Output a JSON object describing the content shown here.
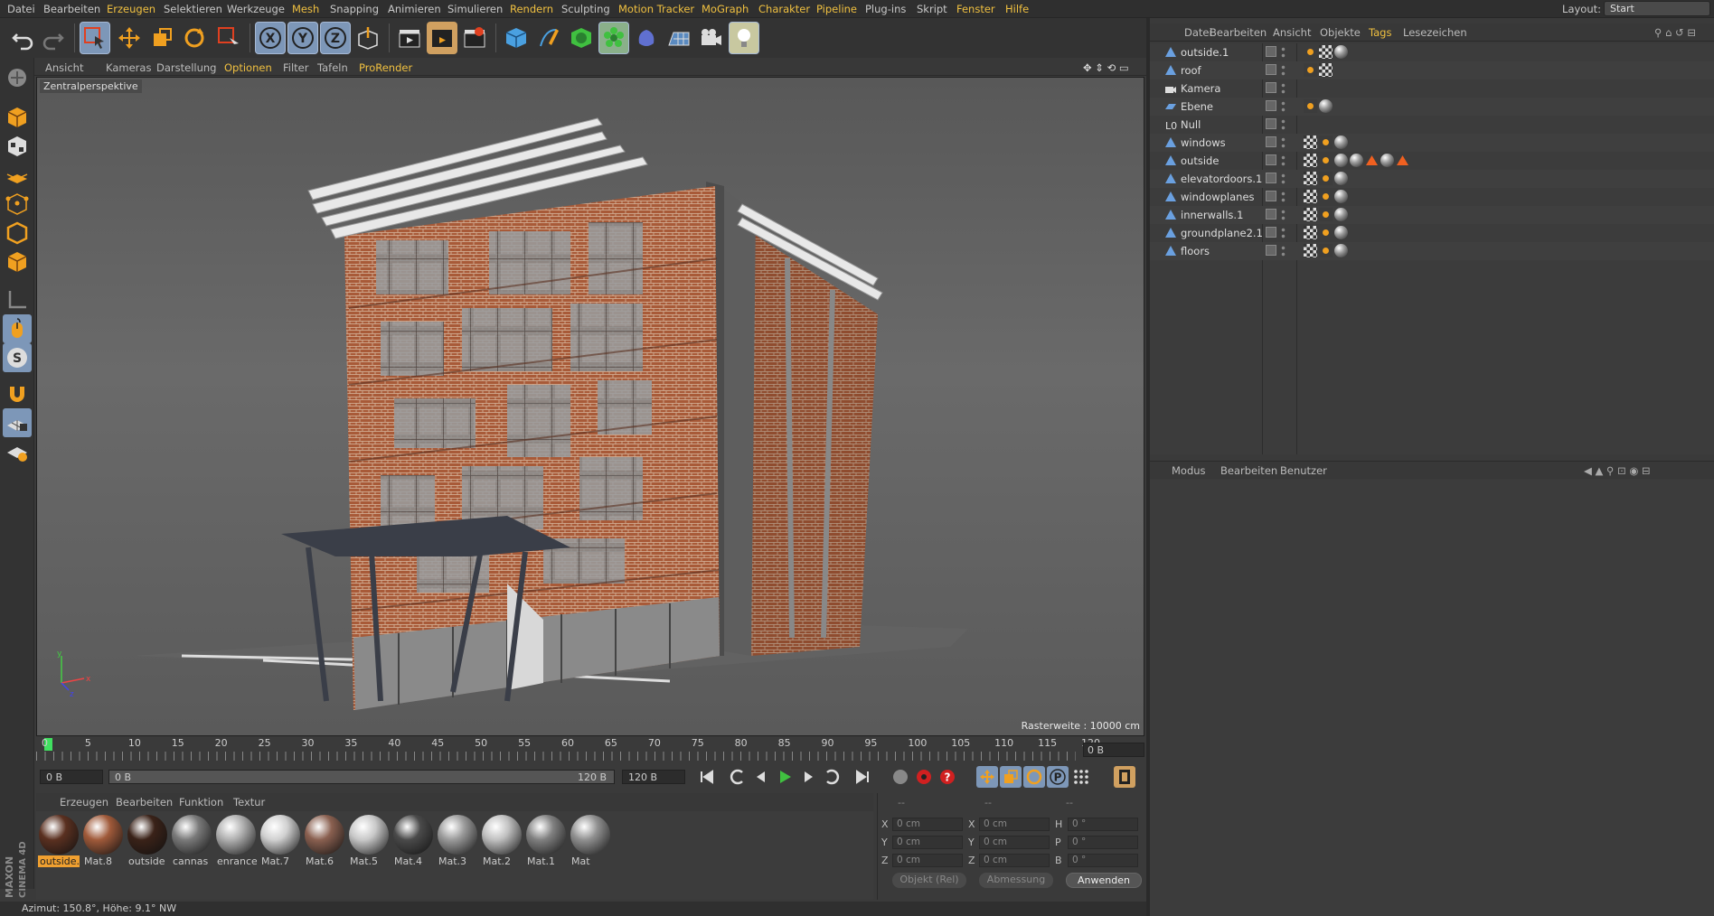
{
  "menubar": {
    "items": [
      {
        "label": "Datei",
        "hl": false
      },
      {
        "label": "Bearbeiten",
        "hl": false
      },
      {
        "label": "Erzeugen",
        "hl": true
      },
      {
        "label": "Selektieren",
        "hl": false
      },
      {
        "label": "Werkzeuge",
        "hl": false
      },
      {
        "label": "Mesh",
        "hl": true
      },
      {
        "label": "Snapping",
        "hl": false
      },
      {
        "label": "Animieren",
        "hl": false
      },
      {
        "label": "Simulieren",
        "hl": false
      },
      {
        "label": "Rendern",
        "hl": true
      },
      {
        "label": "Sculpting",
        "hl": false
      },
      {
        "label": "Motion Tracker",
        "hl": true
      },
      {
        "label": "MoGraph",
        "hl": true
      },
      {
        "label": "Charakter",
        "hl": true
      },
      {
        "label": "Pipeline",
        "hl": true
      },
      {
        "label": "Plug-ins",
        "hl": false
      },
      {
        "label": "Skript",
        "hl": false
      },
      {
        "label": "Fenster",
        "hl": true
      },
      {
        "label": "Hilfe",
        "hl": true
      }
    ],
    "layout_label": "Layout:",
    "layout_value": "Start"
  },
  "viewport": {
    "menu": [
      {
        "label": "Ansicht",
        "hl": false
      },
      {
        "label": "Kameras",
        "hl": false
      },
      {
        "label": "Darstellung",
        "hl": false
      },
      {
        "label": "Optionen",
        "hl": true
      },
      {
        "label": "Filter",
        "hl": false
      },
      {
        "label": "Tafeln",
        "hl": false
      },
      {
        "label": "ProRender",
        "hl": true
      }
    ],
    "title": "Zentralperspektive",
    "raster": "Rasterweite : 10000 cm"
  },
  "timeline": {
    "ticks": [
      "0",
      "5",
      "10",
      "15",
      "20",
      "25",
      "30",
      "35",
      "40",
      "45",
      "50",
      "55",
      "60",
      "65",
      "70",
      "75",
      "80",
      "85",
      "90",
      "95",
      "100",
      "105",
      "110",
      "115",
      "120"
    ],
    "current_frame": "0 B"
  },
  "transport": {
    "start": "0 B",
    "range_start": "0 B",
    "range_end": "120 B",
    "end": "120 B"
  },
  "materials": {
    "menu": [
      "Erzeugen",
      "Bearbeiten",
      "Funktion",
      "Textur"
    ],
    "items": [
      {
        "label": "outside.",
        "color": "#5a3020",
        "active": true
      },
      {
        "label": "Mat.8",
        "color": "#a05a3a",
        "active": false
      },
      {
        "label": "outside",
        "color": "#3a2218",
        "active": false
      },
      {
        "label": "cannas",
        "color": "#7a7a7a",
        "active": false
      },
      {
        "label": "enrance",
        "color": "#b0b0b0",
        "active": false
      },
      {
        "label": "Mat.7",
        "color": "#d0d0d0",
        "active": false
      },
      {
        "label": "Mat.6",
        "color": "#8a6050",
        "active": false
      },
      {
        "label": "Mat.5",
        "color": "#c8c8c8",
        "active": false
      },
      {
        "label": "Mat.4",
        "color": "#4a4a4a",
        "active": false
      },
      {
        "label": "Mat.3",
        "color": "#9a9a9a",
        "active": false
      },
      {
        "label": "Mat.2",
        "color": "#c0c0c0",
        "active": false
      },
      {
        "label": "Mat.1",
        "color": "#808080",
        "active": false
      },
      {
        "label": "Mat",
        "color": "#909090",
        "active": false
      }
    ]
  },
  "coords": {
    "headers": [
      "--",
      "--",
      "--"
    ],
    "rows": [
      {
        "a": "X",
        "av": "0 cm",
        "b": "X",
        "bv": "0 cm",
        "c": "H",
        "cv": "0 °"
      },
      {
        "a": "Y",
        "av": "0 cm",
        "b": "Y",
        "bv": "0 cm",
        "c": "P",
        "cv": "0 °"
      },
      {
        "a": "Z",
        "av": "0 cm",
        "b": "Z",
        "bv": "0 cm",
        "c": "B",
        "cv": "0 °"
      }
    ],
    "mode": "Objekt (Rel)",
    "size": "Abmessung",
    "apply": "Anwenden"
  },
  "status": "Azimut: 150.8°, Höhe: 9.1°  NW",
  "objects": {
    "menu": [
      {
        "label": "Datei",
        "hl": false
      },
      {
        "label": "Bearbeiten",
        "hl": false
      },
      {
        "label": "Ansicht",
        "hl": false
      },
      {
        "label": "Objekte",
        "hl": false
      },
      {
        "label": "Tags",
        "hl": true
      },
      {
        "label": "Lesezeichen",
        "hl": false
      }
    ],
    "rows": [
      {
        "name": "outside.1",
        "icon": "polygon-object-icon",
        "tags": [
          "phong-tag-icon",
          "texture-tag-icon",
          "material-tag-icon"
        ]
      },
      {
        "name": "roof",
        "icon": "polygon-object-icon",
        "tags": [
          "phong-tag-icon",
          "texture-tag-icon"
        ]
      },
      {
        "name": "Kamera",
        "icon": "camera-icon",
        "tags": []
      },
      {
        "name": "Ebene",
        "icon": "plane-icon",
        "tags": [
          "phong-tag-icon",
          "material-tag-icon"
        ]
      },
      {
        "name": "Null",
        "icon": "null-object-icon",
        "tags": []
      },
      {
        "name": "windows",
        "icon": "polygon-object-icon",
        "tags": [
          "texture-tag-icon",
          "phong-tag-icon",
          "material-tag-icon"
        ]
      },
      {
        "name": "outside",
        "icon": "polygon-object-icon",
        "tags": [
          "texture-tag-icon",
          "phong-tag-icon",
          "material-tag-icon",
          "material-tag-icon",
          "warning-icon",
          "material-tag-icon",
          "warning-icon"
        ]
      },
      {
        "name": "elevatordoors.1",
        "icon": "polygon-object-icon",
        "tags": [
          "texture-tag-icon",
          "phong-tag-icon",
          "material-tag-icon"
        ]
      },
      {
        "name": "windowplanes",
        "icon": "polygon-object-icon",
        "tags": [
          "texture-tag-icon",
          "phong-tag-icon",
          "material-tag-icon"
        ]
      },
      {
        "name": "innerwalls.1",
        "icon": "polygon-object-icon",
        "tags": [
          "texture-tag-icon",
          "phong-tag-icon",
          "material-tag-icon"
        ]
      },
      {
        "name": "groundplane2.1",
        "icon": "polygon-object-icon",
        "tags": [
          "texture-tag-icon",
          "phong-tag-icon",
          "material-tag-icon"
        ]
      },
      {
        "name": "floors",
        "icon": "polygon-object-icon",
        "tags": [
          "texture-tag-icon",
          "phong-tag-icon",
          "material-tag-icon"
        ]
      }
    ]
  },
  "attributes": {
    "menu": [
      "Modus",
      "Bearbeiten",
      "Benutzer"
    ]
  },
  "branding": "MAXON CINEMA 4D"
}
